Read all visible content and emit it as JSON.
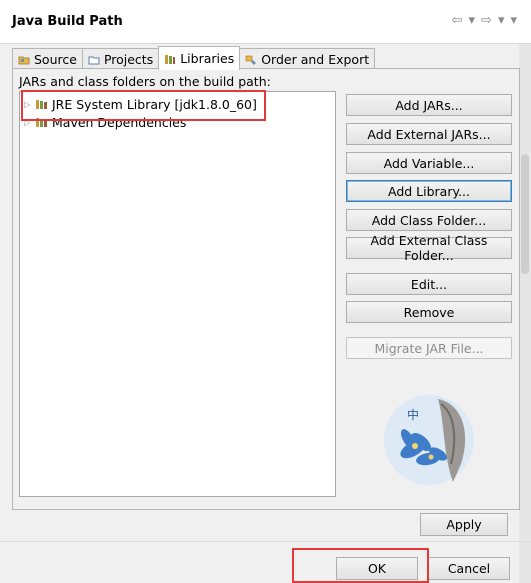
{
  "dialog": {
    "title": "Java Build Path"
  },
  "header_tools": [
    "back-icon",
    "dropdown-icon",
    "forward-icon",
    "dropdown-icon",
    "menu-icon"
  ],
  "tabs": [
    {
      "label": "Source",
      "icon": "source-folder-icon"
    },
    {
      "label": "Projects",
      "icon": "projects-icon"
    },
    {
      "label": "Libraries",
      "icon": "libraries-icon",
      "active": true
    },
    {
      "label": "Order and Export",
      "icon": "order-export-icon"
    }
  ],
  "libraries": {
    "caption": "JARs and class folders on the build path:",
    "items": [
      {
        "label": "JRE System Library [jdk1.8.0_60]",
        "icon": "library-icon",
        "highlighted": true
      },
      {
        "label": "Maven Dependencies",
        "icon": "library-icon"
      }
    ]
  },
  "buttons": {
    "add_jars": "Add JARs...",
    "add_external_jars": "Add External JARs...",
    "add_variable": "Add Variable...",
    "add_library": "Add Library...",
    "add_class_folder": "Add Class Folder...",
    "add_external_class_folder": "Add External Class Folder...",
    "edit": "Edit...",
    "remove": "Remove",
    "migrate_jar": "Migrate JAR File...",
    "apply": "Apply",
    "ok": "OK",
    "cancel": "Cancel"
  },
  "avatar_text": "中",
  "colors": {
    "highlight": "#e23a3a",
    "focus": "#3c7fb1"
  }
}
